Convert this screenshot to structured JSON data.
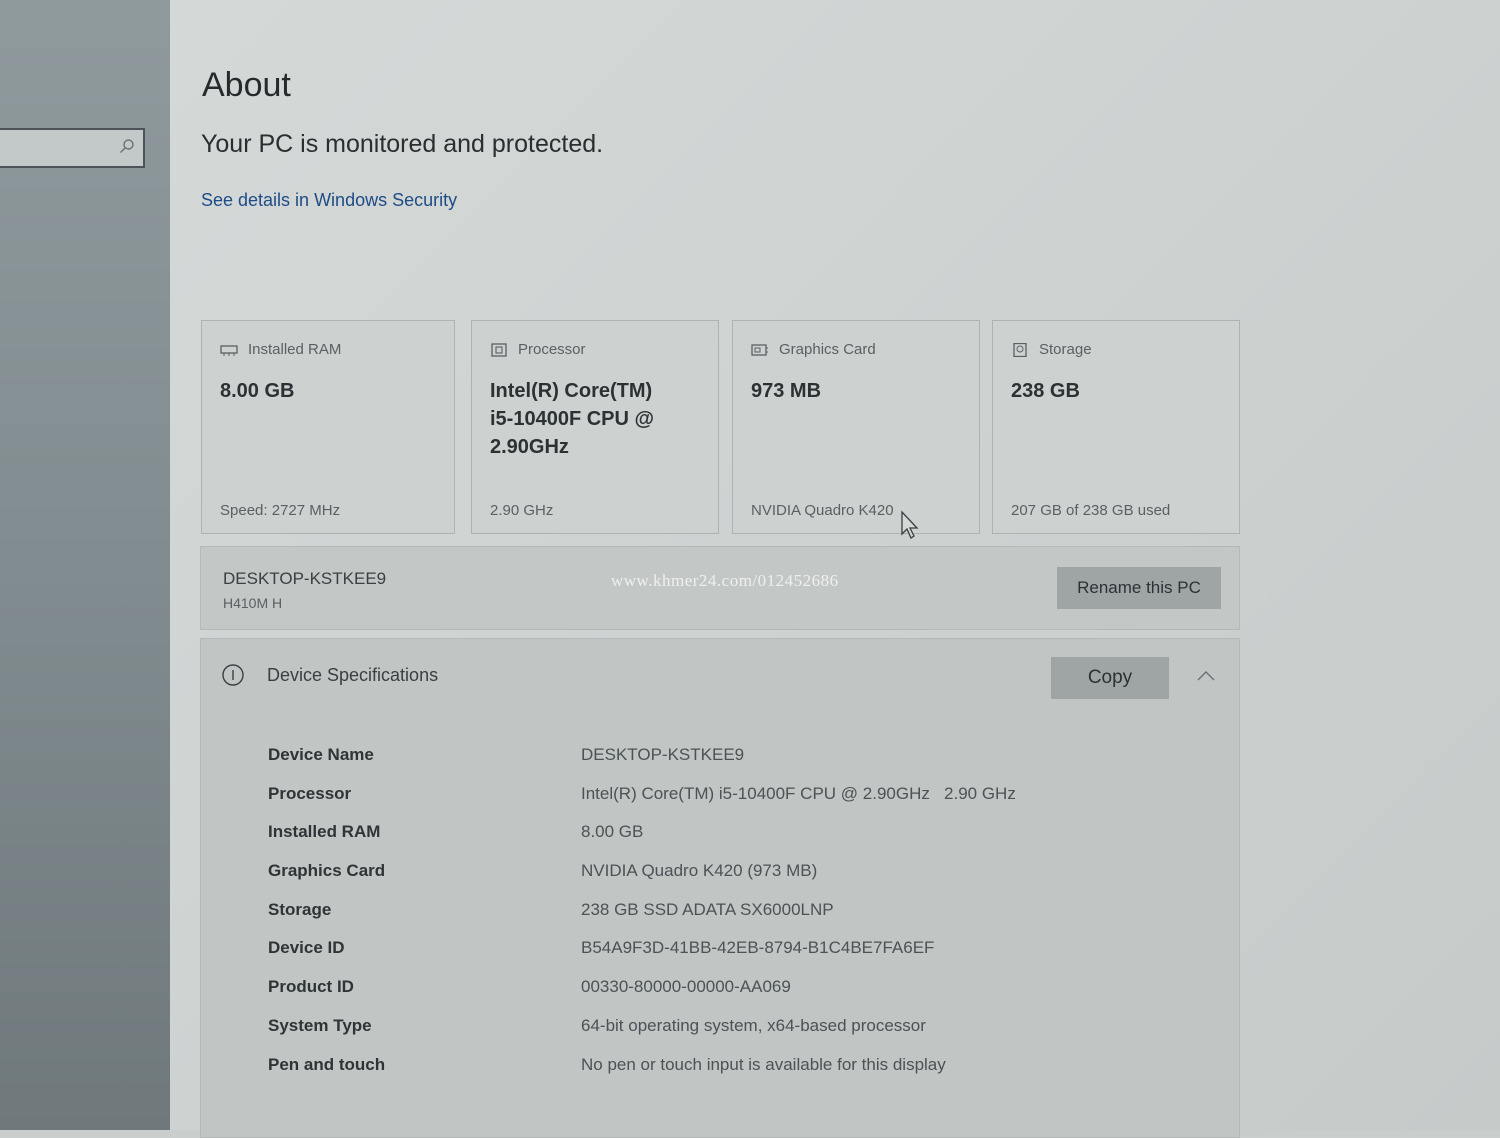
{
  "page": {
    "title": "About",
    "status": "Your PC is monitored and protected.",
    "security_link": "See details in Windows Security"
  },
  "cards": [
    {
      "heading": "Installed RAM",
      "icon": "ram-icon",
      "value": "8.00 GB",
      "footer": "Speed: 2727 MHz"
    },
    {
      "heading": "Processor",
      "icon": "processor-icon",
      "value": "Intel(R) Core(TM) i5-10400F CPU @ 2.90GHz",
      "footer": "2.90 GHz"
    },
    {
      "heading": "Graphics Card",
      "icon": "graphics-card-icon",
      "value": "973 MB",
      "footer": "NVIDIA Quadro K420"
    },
    {
      "heading": "Storage",
      "icon": "storage-icon",
      "value": "238 GB",
      "footer": "207 GB of 238 GB used"
    }
  ],
  "pc": {
    "name": "DESKTOP-KSTKEE9",
    "model": "H410M H",
    "rename_label": "Rename this PC",
    "watermark": "www.khmer24.com/012452686"
  },
  "specs": {
    "heading": "Device Specifications",
    "copy_label": "Copy",
    "rows": [
      {
        "label": "Device Name",
        "value": "DESKTOP-KSTKEE9"
      },
      {
        "label": "Processor",
        "value": "Intel(R) Core(TM) i5-10400F CPU @ 2.90GHz   2.90 GHz"
      },
      {
        "label": "Installed RAM",
        "value": "8.00 GB"
      },
      {
        "label": "Graphics Card",
        "value": "NVIDIA Quadro K420 (973 MB)"
      },
      {
        "label": "Storage",
        "value": "238 GB SSD ADATA SX6000LNP"
      },
      {
        "label": "Device ID",
        "value": "B54A9F3D-41BB-42EB-8794-B1C4BE7FA6EF"
      },
      {
        "label": "Product ID",
        "value": "00330-80000-00000-AA069"
      },
      {
        "label": "System Type",
        "value": "64-bit operating system, x64-based processor"
      },
      {
        "label": "Pen and touch",
        "value": "No pen or touch input is available for this display"
      }
    ]
  },
  "colors": {
    "link": "#1e4c86",
    "button": "#9fa4a4",
    "sidebar": "#818c90"
  }
}
